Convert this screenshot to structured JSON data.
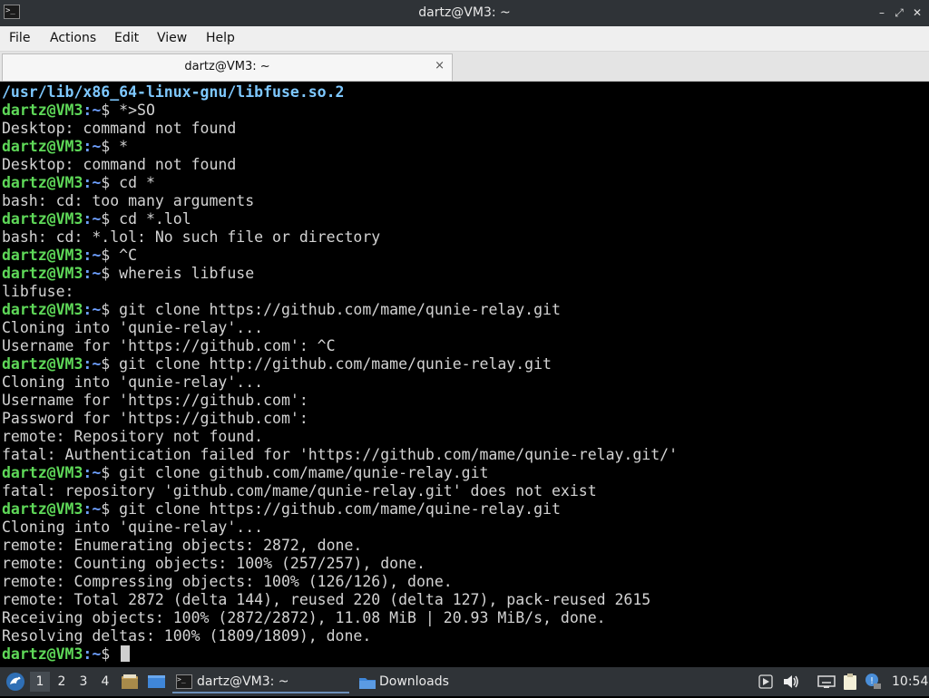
{
  "window": {
    "title": "dartz@VM3: ~",
    "icon": "terminal-icon"
  },
  "menu": [
    "File",
    "Actions",
    "Edit",
    "View",
    "Help"
  ],
  "tab": {
    "label": "dartz@VM3: ~",
    "close": "×"
  },
  "terminal": {
    "prompt_user": "dartz@VM3",
    "prompt_path": ":~",
    "prompt_sigil": "$ ",
    "lines": [
      {
        "type": "output",
        "highlight": true,
        "text": "/usr/lib/x86_64-linux-gnu/libfuse.so.2"
      },
      {
        "type": "prompt",
        "cmd": "*>SO"
      },
      {
        "type": "output",
        "text": "Desktop: command not found"
      },
      {
        "type": "prompt",
        "cmd": "*"
      },
      {
        "type": "output",
        "text": "Desktop: command not found"
      },
      {
        "type": "prompt",
        "cmd": "cd *"
      },
      {
        "type": "output",
        "text": "bash: cd: too many arguments"
      },
      {
        "type": "prompt",
        "cmd": "cd *.lol"
      },
      {
        "type": "output",
        "text": "bash: cd: *.lol: No such file or directory"
      },
      {
        "type": "prompt",
        "cmd": "^C"
      },
      {
        "type": "prompt",
        "cmd": "whereis libfuse"
      },
      {
        "type": "output",
        "text": "libfuse:"
      },
      {
        "type": "prompt",
        "cmd": "git clone https://github.com/mame/qunie-relay.git"
      },
      {
        "type": "output",
        "text": "Cloning into 'qunie-relay'..."
      },
      {
        "type": "output",
        "text": "Username for 'https://github.com': ^C"
      },
      {
        "type": "prompt",
        "cmd": "git clone http://github.com/mame/qunie-relay.git"
      },
      {
        "type": "output",
        "text": "Cloning into 'qunie-relay'..."
      },
      {
        "type": "output",
        "text": "Username for 'https://github.com':"
      },
      {
        "type": "output",
        "text": "Password for 'https://github.com':"
      },
      {
        "type": "output",
        "text": "remote: Repository not found."
      },
      {
        "type": "output",
        "text": "fatal: Authentication failed for 'https://github.com/mame/qunie-relay.git/'"
      },
      {
        "type": "prompt",
        "cmd": "git clone github.com/mame/qunie-relay.git"
      },
      {
        "type": "output",
        "text": "fatal: repository 'github.com/mame/qunie-relay.git' does not exist"
      },
      {
        "type": "prompt",
        "cmd": "git clone https://github.com/mame/quine-relay.git"
      },
      {
        "type": "output",
        "text": "Cloning into 'quine-relay'..."
      },
      {
        "type": "output",
        "text": "remote: Enumerating objects: 2872, done."
      },
      {
        "type": "output",
        "text": "remote: Counting objects: 100% (257/257), done."
      },
      {
        "type": "output",
        "text": "remote: Compressing objects: 100% (126/126), done."
      },
      {
        "type": "output",
        "text": "remote: Total 2872 (delta 144), reused 220 (delta 127), pack-reused 2615"
      },
      {
        "type": "output",
        "text": "Receiving objects: 100% (2872/2872), 11.08 MiB | 20.93 MiB/s, done."
      },
      {
        "type": "output",
        "text": "Resolving deltas: 100% (1809/1809), done."
      },
      {
        "type": "prompt",
        "cmd": "",
        "cursor": true
      }
    ]
  },
  "taskbar": {
    "workspaces": [
      "1",
      "2",
      "3",
      "4"
    ],
    "active_workspace": "1",
    "tasks": [
      {
        "label": "dartz@VM3: ~",
        "icon": "terminal-icon",
        "active": true
      },
      {
        "label": "Downloads",
        "icon": "folder-icon",
        "active": false
      }
    ],
    "clock": "10:54",
    "colors": {
      "taskbar_bg": "#2f3337",
      "prompt_user": "#5ed858",
      "prompt_path": "#6ea0ff"
    }
  }
}
